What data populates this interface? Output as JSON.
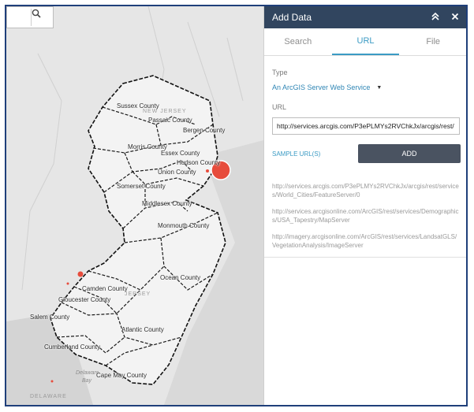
{
  "map": {
    "search_placeholder": "",
    "search_icon": "search-icon",
    "counties": [
      "Sussex County",
      "Passaic County",
      "Bergen County",
      "Morris County",
      "Essex County",
      "Hudson County",
      "Union County",
      "Somerset County",
      "Middlesex County",
      "Monmouth County",
      "Ocean County",
      "Camden County",
      "Gloucester County",
      "Salem County",
      "Atlantic County",
      "Cumberland County",
      "Cape May County"
    ],
    "state_labels": {
      "nj_north": "NEW JERSEY",
      "nj_south": "JERSEY",
      "delaware": "DELAWARE"
    },
    "water_labels": {
      "bay_1": "Delaware",
      "bay_2": "Bay"
    },
    "colors": {
      "land": "#ededed",
      "water": "#d6d6d6",
      "marker": "#e74c3c"
    }
  },
  "panel": {
    "title": "Add Data",
    "collapse_icon": "double-chevron-up-icon",
    "close_icon": "close-icon",
    "collapse_glyph": "≈",
    "close_glyph": "✕",
    "tabs": [
      {
        "label": "Search",
        "active": false
      },
      {
        "label": "URL",
        "active": true
      },
      {
        "label": "File",
        "active": false
      }
    ],
    "type_label": "Type",
    "type_value": "An ArcGIS Server Web Service",
    "url_label": "URL",
    "url_value": "http://services.arcgis.com/P3ePLMYs2RVChkJx/arcgis/rest/",
    "sample_link": "SAMPLE URL(S)",
    "add_button": "ADD",
    "sample_urls": [
      "http://services.arcgis.com/P3ePLMYs2RVChkJx/arcgis/rest/services/World_Cities/FeatureServer/0",
      "http://services.arcgisonline.com/ArcGIS/rest/services/Demographics/USA_Tapestry/MapServer",
      "http://imagery.arcgisonline.com/ArcGIS/rest/services/LandsatGLS/VegetationAnalysis/ImageServer"
    ],
    "colors": {
      "header": "#31455f",
      "accent": "#3b9bc4",
      "button": "#4a5361"
    }
  }
}
